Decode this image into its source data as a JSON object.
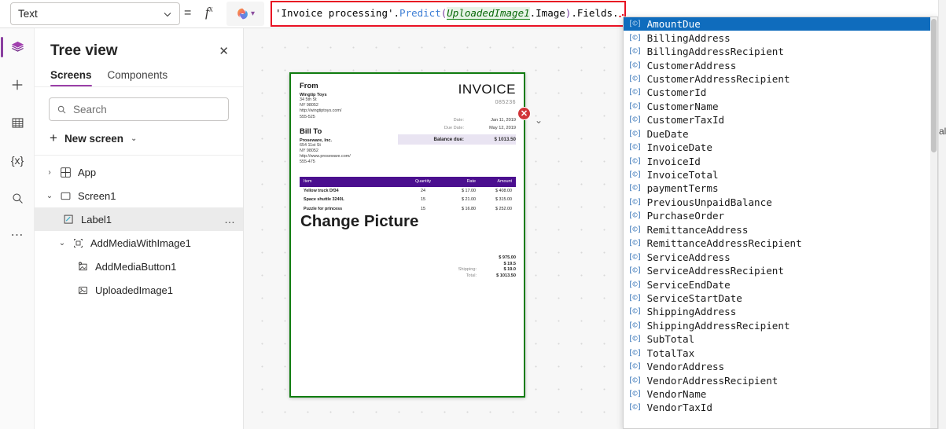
{
  "topbar": {
    "property_select": {
      "value": "Text",
      "chevron": "chevron-down-icon"
    },
    "equals": "=",
    "fx": "f",
    "fx_sup": "x",
    "copilot": {
      "icon": "copilot-icon",
      "chevron": "chevron-down-icon"
    },
    "formula": {
      "part_string": "'Invoice processing'",
      "dot1": ".",
      "part_fn": "Predict",
      "paren_open": "(",
      "part_param": "UploadedImage1",
      "part_image": ".Image",
      "paren_close": ")",
      "part_fields": ".Fields",
      "dot_end": "."
    },
    "highlight_color": "#e81123"
  },
  "rail": {
    "items": [
      {
        "name": "layers-icon",
        "label": "Tree view",
        "active": true
      },
      {
        "name": "plus-icon",
        "label": "Insert",
        "active": false
      },
      {
        "name": "table-icon",
        "label": "Data",
        "active": false
      },
      {
        "name": "variables-icon",
        "label": "{x}",
        "active": false
      },
      {
        "name": "search-icon",
        "label": "Search",
        "active": false
      },
      {
        "name": "more-icon",
        "label": "More",
        "active": false
      }
    ],
    "accent": "#8a3fa0"
  },
  "tree": {
    "title": "Tree view",
    "close": "✕",
    "tabs": [
      {
        "label": "Screens",
        "active": true
      },
      {
        "label": "Components",
        "active": false
      }
    ],
    "search": {
      "placeholder": "Search",
      "value": ""
    },
    "new_screen": {
      "label": "New screen",
      "plus": "+",
      "chevron": "⌄"
    },
    "nodes": [
      {
        "label": "App",
        "icon": "app-icon",
        "twist": "›",
        "indent": 0,
        "selected": false,
        "dots": ""
      },
      {
        "label": "Screen1",
        "icon": "screen-icon",
        "twist": "⌄",
        "indent": 0,
        "selected": false,
        "dots": ""
      },
      {
        "label": "Label1",
        "icon": "label-icon",
        "twist": "",
        "indent": 1,
        "selected": true,
        "dots": "…"
      },
      {
        "label": "AddMediaWithImage1",
        "icon": "group-icon",
        "twist": "⌄",
        "indent": 1,
        "selected": false,
        "dots": ""
      },
      {
        "label": "AddMediaButton1",
        "icon": "add-media-icon",
        "twist": "",
        "indent": 2,
        "selected": false,
        "dots": ""
      },
      {
        "label": "UploadedImage1",
        "icon": "image-icon",
        "twist": "",
        "indent": 2,
        "selected": false,
        "dots": ""
      }
    ]
  },
  "canvas": {
    "selection_color": "#107c10",
    "error_badge": "✕",
    "chevron": "⌄",
    "label_text": "Change Picture",
    "invoice": {
      "from_heading": "From",
      "from_company": "Wingtip Toys",
      "from_lines": [
        "34 5th St",
        "NY 98052",
        "http://wingtiptoys.com/",
        "555-525"
      ],
      "billto_heading": "Bill To",
      "billto_company": "Proseware, Inc.",
      "billto_lines": [
        "654 11st St",
        "NY 98052",
        "http://www.proseware.com/",
        "555-475"
      ],
      "title": "INVOICE",
      "number": "085236",
      "date_label": "Date:",
      "date_value": "Jan 11, 2019",
      "due_label": "Due Date:",
      "due_value": "May 12, 2019",
      "balance_label": "Balance due:",
      "balance_value": "$ 1013.50",
      "columns": [
        "Item",
        "Quantity",
        "Rate",
        "Amount"
      ],
      "rows": [
        {
          "item": "Yellow truck Df34",
          "qty": "24",
          "rate": "$ 17.00",
          "amount": "$ 408.00"
        },
        {
          "item": "Space shuttle 3240L",
          "qty": "15",
          "rate": "$ 21.00",
          "amount": "$ 315.00"
        },
        {
          "item": "Puzzle for princess",
          "qty": "15",
          "rate": "$ 16.80",
          "amount": "$ 252.00"
        }
      ],
      "totals": [
        {
          "label": "",
          "value": "$ 975.00"
        },
        {
          "label": "",
          "value": "$ 19.5"
        },
        {
          "label": "Shipping:",
          "value": "$ 19.0"
        },
        {
          "label": "Total:",
          "value": "$ 1013.50"
        }
      ]
    }
  },
  "dropdown": {
    "selected": "AmountDue",
    "item_icon": "[©]",
    "items": [
      "AmountDue",
      "BillingAddress",
      "BillingAddressRecipient",
      "CustomerAddress",
      "CustomerAddressRecipient",
      "CustomerId",
      "CustomerName",
      "CustomerTaxId",
      "DueDate",
      "InvoiceDate",
      "InvoiceId",
      "InvoiceTotal",
      "paymentTerms",
      "PreviousUnpaidBalance",
      "PurchaseOrder",
      "RemittanceAddress",
      "RemittanceAddressRecipient",
      "ServiceAddress",
      "ServiceAddressRecipient",
      "ServiceEndDate",
      "ServiceStartDate",
      "ShippingAddress",
      "ShippingAddressRecipient",
      "SubTotal",
      "TotalTax",
      "VendorAddress",
      "VendorAddressRecipient",
      "VendorName",
      "VendorTaxId"
    ],
    "highlight_color": "#0f6cbd"
  },
  "right_panel": {
    "clipped_text": "al"
  }
}
